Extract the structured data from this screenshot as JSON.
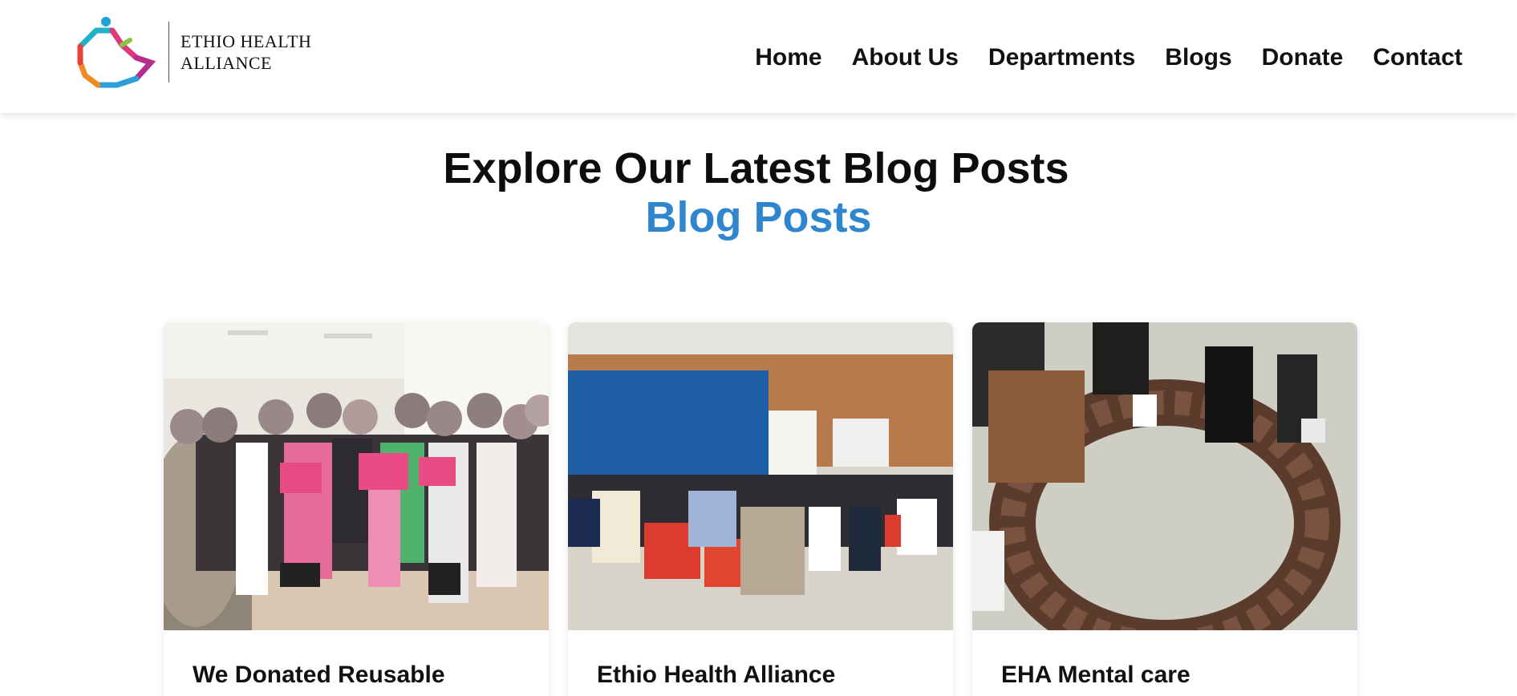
{
  "header": {
    "logo": {
      "line1": "ETHIO HEALTH",
      "line2": "ALLIANCE",
      "icon": "ethio-health-alliance-logo"
    },
    "nav": [
      {
        "label": "Home"
      },
      {
        "label": "About Us"
      },
      {
        "label": "Departments"
      },
      {
        "label": "Blogs"
      },
      {
        "label": "Donate"
      },
      {
        "label": "Contact"
      }
    ]
  },
  "hero": {
    "title": "Explore Our Latest Blog Posts",
    "subtitle": "Blog Posts",
    "subtitle_color": "#2f86cf"
  },
  "posts": [
    {
      "title": "We Donated Reusable",
      "image": "group-holding-pink-certificates-photo"
    },
    {
      "title": "Ethio Health Alliance",
      "image": "seated-audience-hall-photo"
    },
    {
      "title": "EHA Mental care",
      "image": "circle-of-fists-photo"
    }
  ]
}
